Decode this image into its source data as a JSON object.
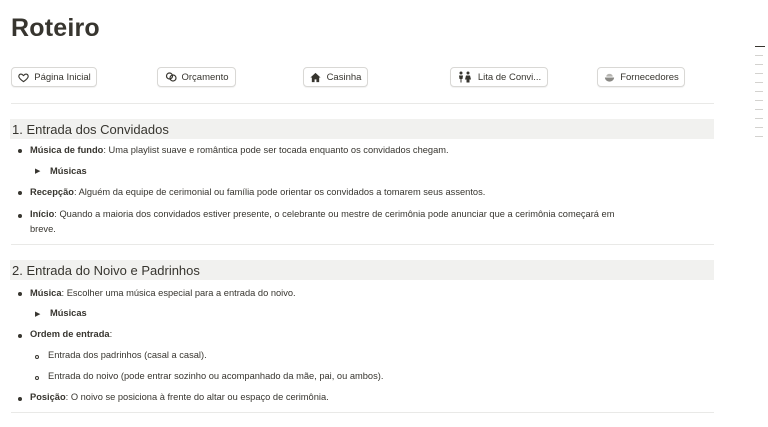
{
  "page": {
    "title": "Roteiro"
  },
  "nav": [
    {
      "label": "Página Inicial",
      "icon": "heart-icon"
    },
    {
      "label": "Orçamento",
      "icon": "coins-icon"
    },
    {
      "label": "Casinha",
      "icon": "home-icon"
    },
    {
      "label": "Lita de Convi...",
      "icon": "people-icon"
    },
    {
      "label": "Fornecedores",
      "icon": "bowl-icon"
    }
  ],
  "sections": [
    {
      "heading": "1. Entrada dos Convidados",
      "items": [
        {
          "label": "Música de fundo",
          "text": ": Uma playlist suave e romântica pode ser tocada enquanto os convidados chegam."
        },
        {
          "toggle": "Músicas"
        },
        {
          "label": "Recepção",
          "text": ": Alguém da equipe de cerimonial ou família pode orientar os convidados a tomarem seus assentos."
        },
        {
          "label": "Início",
          "text": ": Quando a maioria dos convidados estiver presente, o celebrante ou mestre de cerimônia pode anunciar que a cerimônia começará em",
          "text2": "breve."
        }
      ]
    },
    {
      "heading": "2. Entrada do Noivo e Padrinhos",
      "items": [
        {
          "label": "Música",
          "text": ": Escolher uma música especial para a entrada do noivo."
        },
        {
          "toggle": "Músicas"
        },
        {
          "label": "Ordem de entrada",
          "text": ":"
        },
        {
          "sub": "Entrada dos padrinhos (casal a casal)."
        },
        {
          "sub": "Entrada do noivo (pode entrar sozinho ou acompanhado da mãe, pai, ou ambos)."
        },
        {
          "label": "Posição",
          "text": ": O noivo se posiciona à frente do altar ou espaço de cerimônia."
        }
      ]
    }
  ]
}
